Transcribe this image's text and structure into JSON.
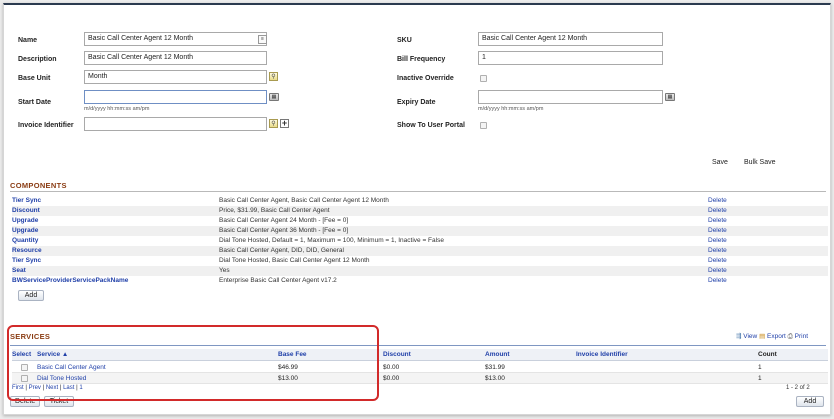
{
  "form": {
    "name_label": "Name",
    "name_value": "Basic Call Center Agent 12 Month",
    "description_label": "Description",
    "description_value": "Basic Call Center Agent 12 Month",
    "base_unit_label": "Base Unit",
    "base_unit_value": "Month",
    "start_date_label": "Start Date",
    "start_date_value": "",
    "start_date_hint": "m/d/yyyy hh:mm:ss am/pm",
    "invoice_identifier_label": "Invoice Identifier",
    "invoice_identifier_value": "",
    "sku_label": "SKU",
    "sku_value": "Basic Call Center Agent 12 Month",
    "bill_frequency_label": "Bill Frequency",
    "bill_frequency_value": "1",
    "inactive_override_label": "Inactive Override",
    "inactive_override_checked": false,
    "expiry_date_label": "Expiry Date",
    "expiry_date_value": "",
    "expiry_date_hint": "m/d/yyyy hh:mm:ss am/pm",
    "show_to_user_portal_label": "Show To User Portal",
    "show_to_user_portal_checked": false,
    "save_label": "Save",
    "bulk_save_label": "Bulk Save"
  },
  "components": {
    "title": "COMPONENTS",
    "rows": [
      {
        "type": "Tier Sync",
        "detail": "Basic Call Center Agent, Basic Call Center Agent 12 Month",
        "action": "Delete"
      },
      {
        "type": "Discount",
        "detail": "Price, $31.99, Basic Call Center Agent",
        "action": "Delete"
      },
      {
        "type": "Upgrade",
        "detail": "Basic Call Center Agent 24 Month - [Fee = 0]",
        "action": "Delete"
      },
      {
        "type": "Upgrade",
        "detail": "Basic Call Center Agent 36 Month - [Fee = 0]",
        "action": "Delete"
      },
      {
        "type": "Quantity",
        "detail": "Dial Tone Hosted, Default = 1, Maximum = 100, Minimum = 1, Inactive = False",
        "action": "Delete"
      },
      {
        "type": "Resource",
        "detail": "Basic Call Center Agent, DID, DID, General",
        "action": "Delete"
      },
      {
        "type": "Tier Sync",
        "detail": "Dial Tone Hosted, Basic Call Center Agent 12 Month",
        "action": "Delete"
      },
      {
        "type": "Seat",
        "detail": "Yes",
        "action": "Delete"
      },
      {
        "type": "BWServiceProviderServicePackName",
        "detail": "Enterprise Basic Call Center Agent v17.2",
        "action": "Delete"
      }
    ],
    "add_label": "Add"
  },
  "services": {
    "title": "SERVICES",
    "view_label": "View",
    "export_label": "Export",
    "print_label": "Print",
    "columns": [
      "Select",
      "Service ▲",
      "Base Fee",
      "Discount",
      "Amount",
      "Invoice Identifier",
      "Count"
    ],
    "rows": [
      {
        "service": "Basic Call Center Agent",
        "base_fee": "$46.99",
        "discount": "$0.00",
        "amount": "$31.99",
        "invoice_identifier": "",
        "count": "1"
      },
      {
        "service": "Dial Tone Hosted",
        "base_fee": "$13.00",
        "discount": "$0.00",
        "amount": "$13.00",
        "invoice_identifier": "",
        "count": "1"
      }
    ],
    "pager": {
      "first": "First",
      "prev": "Prev",
      "next": "Next",
      "last": "Last",
      "page": "1",
      "sep": "|"
    },
    "range_text": "1 - 2 of 2",
    "delete_label": "Delete",
    "ticket_label": "Ticket",
    "add_label": "Add"
  },
  "colors": {
    "section_title": "#8a3c13",
    "link": "#1f3fa8",
    "highlight_border": "#d22a2a",
    "header_bar": "#2b3a4f"
  }
}
